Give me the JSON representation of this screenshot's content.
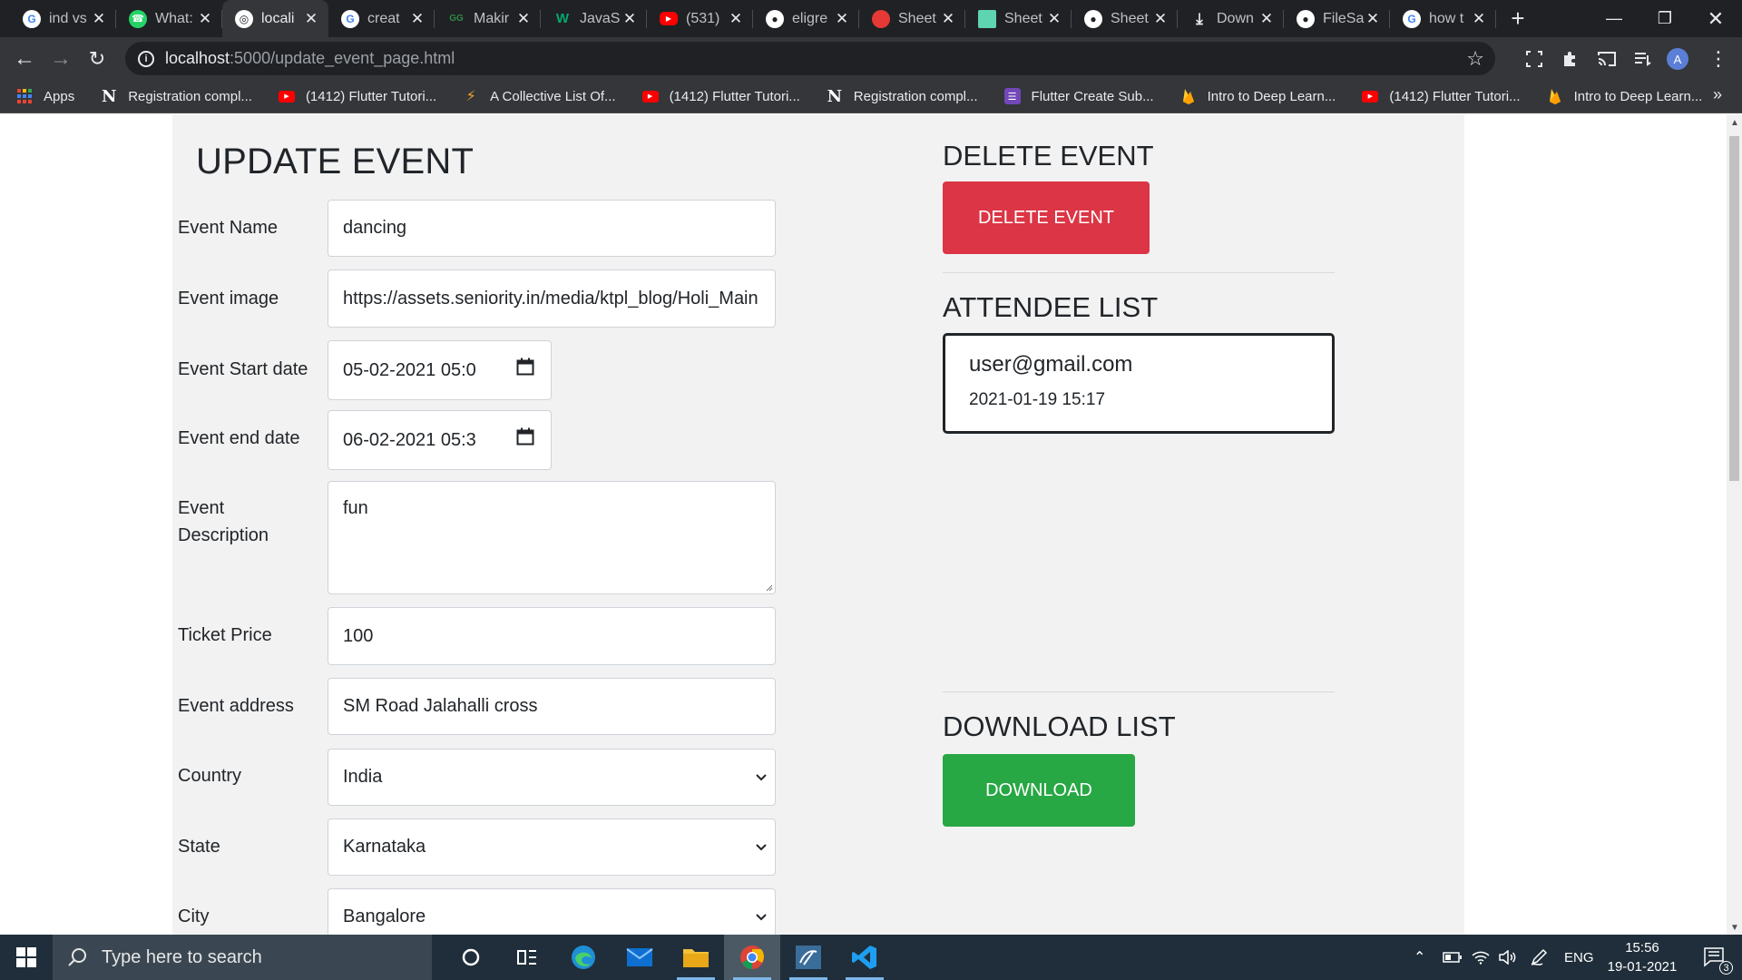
{
  "browser": {
    "tabs": [
      {
        "label": "ind vs",
        "icon": "google-icon",
        "color": "#4285f4"
      },
      {
        "label": "What:",
        "icon": "whatsapp-icon",
        "color": "#25d366"
      },
      {
        "label": "locali",
        "icon": "globe-icon",
        "color": "#e8eaed"
      },
      {
        "label": "creat",
        "icon": "google-icon",
        "color": "#4285f4"
      },
      {
        "label": "Makir",
        "icon": "geeks-icon",
        "color": "#2f8d46"
      },
      {
        "label": "JavaS",
        "icon": "w3schools-icon",
        "color": "#04aa6d"
      },
      {
        "label": "(531)",
        "icon": "youtube-icon",
        "color": "#ff0000"
      },
      {
        "label": "eligre",
        "icon": "github-icon",
        "color": "#e8eaed"
      },
      {
        "label": "Sheet",
        "icon": "sheetlabs-icon",
        "color": "#e53935"
      },
      {
        "label": "Sheet",
        "icon": "sheets-icon",
        "color": "#5fd4b0"
      },
      {
        "label": "Sheet",
        "icon": "github-icon",
        "color": "#e8eaed"
      },
      {
        "label": "Down",
        "icon": "download-icon",
        "color": "#e8eaed"
      },
      {
        "label": "FileSa",
        "icon": "github-icon",
        "color": "#e8eaed"
      },
      {
        "label": "how t",
        "icon": "google-icon",
        "color": "#4285f4"
      }
    ],
    "url_host": "localhost",
    "url_path": ":5000/update_event_page.html",
    "profile_initial": "A",
    "bookmarks": [
      {
        "label": "Apps",
        "icon": "apps-grid-icon",
        "color": "#ea4335"
      },
      {
        "label": "Registration compl...",
        "icon": "notion-icon",
        "color": "#ffffff"
      },
      {
        "label": "(1412) Flutter Tutori...",
        "icon": "youtube-icon",
        "color": "#ff0000"
      },
      {
        "label": "A Collective List Of...",
        "icon": "bolt-icon",
        "color": "#f4a52a"
      },
      {
        "label": "(1412) Flutter Tutori...",
        "icon": "youtube-icon",
        "color": "#ff0000"
      },
      {
        "label": "Registration compl...",
        "icon": "notion-icon",
        "color": "#ffffff"
      },
      {
        "label": "Flutter Create Sub...",
        "icon": "forms-icon",
        "color": "#7248b9"
      },
      {
        "label": "Intro to Deep Learn...",
        "icon": "firebase-icon",
        "color": "#ffca28"
      },
      {
        "label": "(1412) Flutter Tutori...",
        "icon": "youtube-icon",
        "color": "#ff0000"
      },
      {
        "label": "Intro to Deep Learn...",
        "icon": "firebase-icon",
        "color": "#ffca28"
      }
    ],
    "more_bookmarks": "»"
  },
  "form": {
    "title": "UPDATE EVENT",
    "labels": {
      "name": "Event Name",
      "image": "Event image",
      "start": "Event Start date",
      "end": "Event end date",
      "description_1": "Event",
      "description_2": "Description",
      "price": "Ticket Price",
      "address": "Event address",
      "country": "Country",
      "state": "State",
      "city": "City"
    },
    "values": {
      "name": "dancing",
      "image": "https://assets.seniority.in/media/ktpl_blog/Holi_Main",
      "start": "05-02-2021 05:0",
      "end": "06-02-2021 05:3",
      "description": "fun",
      "price": "100",
      "address": "SM Road Jalahalli cross",
      "country": "India",
      "state": "Karnataka",
      "city": "Bangalore"
    }
  },
  "sidebar": {
    "delete_heading": "DELETE EVENT",
    "delete_button": "DELETE EVENT",
    "attendee_heading": "ATTENDEE LIST",
    "attendees": [
      {
        "email": "user@gmail.com",
        "time": "2021-01-19 15:17"
      }
    ],
    "download_heading": "DOWNLOAD LIST",
    "download_button": "DOWNLOAD"
  },
  "colors": {
    "delete": "#dc3545",
    "download": "#28a745",
    "panel": "#f2f2f2"
  },
  "taskbar": {
    "search_placeholder": "Type here to search",
    "language": "ENG",
    "time": "15:56",
    "date": "19-01-2021",
    "notification_count": "3"
  }
}
